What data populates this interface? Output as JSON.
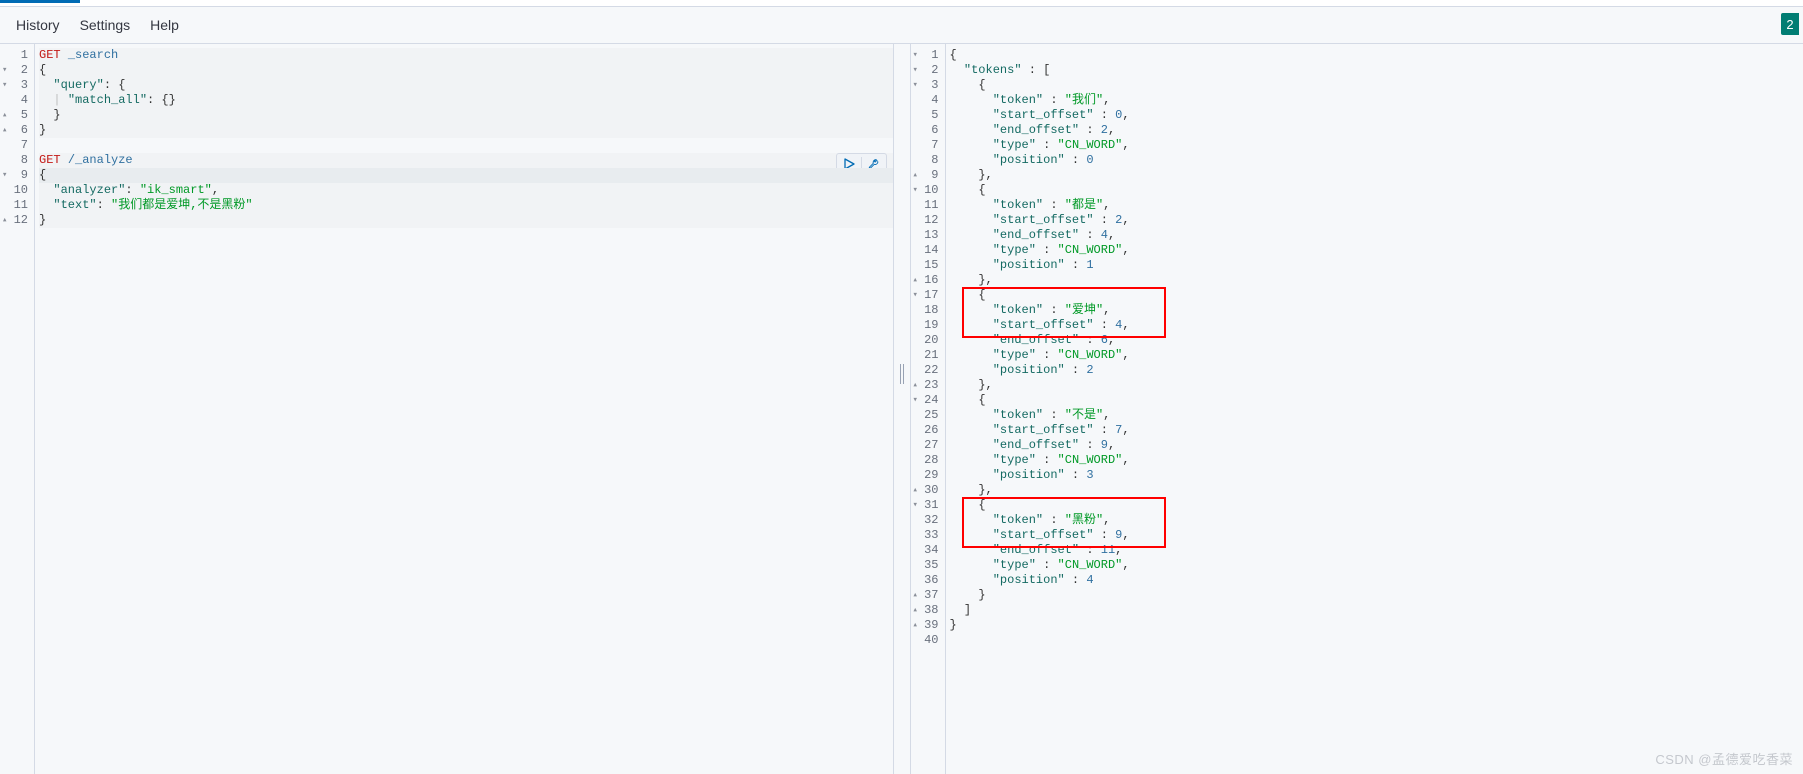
{
  "menu": {
    "history": "History",
    "settings": "Settings",
    "help": "Help",
    "badge": "2"
  },
  "request": {
    "active_line": 9,
    "lines": [
      {
        "n": 1,
        "fold": "",
        "parts": [
          {
            "c": "m",
            "t": "GET"
          },
          {
            "c": "pl",
            "t": " "
          },
          {
            "c": "p",
            "t": "_search"
          }
        ],
        "bg": "q1qbg"
      },
      {
        "n": 2,
        "fold": "▾",
        "parts": [
          {
            "c": "pu",
            "t": "{"
          }
        ],
        "bg": "q1qbg"
      },
      {
        "n": 3,
        "fold": "▾",
        "parts": [
          {
            "c": "pl",
            "t": "  "
          },
          {
            "c": "k",
            "t": "\"query\""
          },
          {
            "c": "pu",
            "t": ": {"
          }
        ],
        "bg": "q1qbg"
      },
      {
        "n": 4,
        "fold": "",
        "parts": [
          {
            "c": "pl",
            "t": "  "
          },
          {
            "c": "ig",
            "t": "|"
          },
          {
            "c": "pl",
            "t": " "
          },
          {
            "c": "k",
            "t": "\"match_all\""
          },
          {
            "c": "pu",
            "t": ": {}"
          }
        ],
        "bg": "q1qbg"
      },
      {
        "n": 5,
        "fold": "▴",
        "parts": [
          {
            "c": "pl",
            "t": "  "
          },
          {
            "c": "pu",
            "t": "}"
          }
        ],
        "bg": "q1qbg"
      },
      {
        "n": 6,
        "fold": "▴",
        "parts": [
          {
            "c": "pu",
            "t": "}"
          }
        ],
        "bg": "q1qbg"
      },
      {
        "n": 7,
        "fold": "",
        "parts": [
          {
            "c": "pl",
            "t": " "
          }
        ]
      },
      {
        "n": 8,
        "fold": "",
        "parts": [
          {
            "c": "m",
            "t": "GET"
          },
          {
            "c": "pl",
            "t": " "
          },
          {
            "c": "p",
            "t": "/_analyze"
          }
        ],
        "bg": "q1qbg",
        "actions": true
      },
      {
        "n": 9,
        "fold": "▾",
        "parts": [
          {
            "c": "pu",
            "t": "{"
          }
        ],
        "bg": "current"
      },
      {
        "n": 10,
        "fold": "",
        "parts": [
          {
            "c": "pl",
            "t": "  "
          },
          {
            "c": "k",
            "t": "\"analyzer\""
          },
          {
            "c": "pu",
            "t": ": "
          },
          {
            "c": "s",
            "t": "\"ik_smart\""
          },
          {
            "c": "pu",
            "t": ","
          }
        ],
        "bg": "q1qbg"
      },
      {
        "n": 11,
        "fold": "",
        "parts": [
          {
            "c": "pl",
            "t": "  "
          },
          {
            "c": "k",
            "t": "\"text\""
          },
          {
            "c": "pu",
            "t": ": "
          },
          {
            "c": "s",
            "t": "\"我们都是爱坤,不是黑粉\""
          }
        ],
        "bg": "q1qbg"
      },
      {
        "n": 12,
        "fold": "▴",
        "parts": [
          {
            "c": "pu",
            "t": "}"
          }
        ],
        "bg": "q1qbg"
      }
    ]
  },
  "response": {
    "highlights": [
      {
        "top_line": 17,
        "bottom_line": 19
      },
      {
        "top_line": 31,
        "bottom_line": 33
      }
    ],
    "lines": [
      {
        "n": 1,
        "fold": "▾",
        "parts": [
          {
            "c": "pu",
            "t": "{"
          }
        ]
      },
      {
        "n": 2,
        "fold": "▾",
        "parts": [
          {
            "c": "pl",
            "t": "  "
          },
          {
            "c": "k",
            "t": "\"tokens\""
          },
          {
            "c": "pu",
            "t": " : ["
          }
        ]
      },
      {
        "n": 3,
        "fold": "▾",
        "parts": [
          {
            "c": "pl",
            "t": "    "
          },
          {
            "c": "pu",
            "t": "{"
          }
        ]
      },
      {
        "n": 4,
        "fold": "",
        "parts": [
          {
            "c": "pl",
            "t": "      "
          },
          {
            "c": "k",
            "t": "\"token\""
          },
          {
            "c": "pu",
            "t": " : "
          },
          {
            "c": "s",
            "t": "\"我们\""
          },
          {
            "c": "pu",
            "t": ","
          }
        ]
      },
      {
        "n": 5,
        "fold": "",
        "parts": [
          {
            "c": "pl",
            "t": "      "
          },
          {
            "c": "k",
            "t": "\"start_offset\""
          },
          {
            "c": "pu",
            "t": " : "
          },
          {
            "c": "p",
            "t": "0"
          },
          {
            "c": "pu",
            "t": ","
          }
        ]
      },
      {
        "n": 6,
        "fold": "",
        "parts": [
          {
            "c": "pl",
            "t": "      "
          },
          {
            "c": "k",
            "t": "\"end_offset\""
          },
          {
            "c": "pu",
            "t": " : "
          },
          {
            "c": "p",
            "t": "2"
          },
          {
            "c": "pu",
            "t": ","
          }
        ]
      },
      {
        "n": 7,
        "fold": "",
        "parts": [
          {
            "c": "pl",
            "t": "      "
          },
          {
            "c": "k",
            "t": "\"type\""
          },
          {
            "c": "pu",
            "t": " : "
          },
          {
            "c": "s",
            "t": "\"CN_WORD\""
          },
          {
            "c": "pu",
            "t": ","
          }
        ]
      },
      {
        "n": 8,
        "fold": "",
        "parts": [
          {
            "c": "pl",
            "t": "      "
          },
          {
            "c": "k",
            "t": "\"position\""
          },
          {
            "c": "pu",
            "t": " : "
          },
          {
            "c": "p",
            "t": "0"
          }
        ]
      },
      {
        "n": 9,
        "fold": "▴",
        "parts": [
          {
            "c": "pl",
            "t": "    "
          },
          {
            "c": "pu",
            "t": "},"
          }
        ]
      },
      {
        "n": 10,
        "fold": "▾",
        "parts": [
          {
            "c": "pl",
            "t": "    "
          },
          {
            "c": "pu",
            "t": "{"
          }
        ]
      },
      {
        "n": 11,
        "fold": "",
        "parts": [
          {
            "c": "pl",
            "t": "      "
          },
          {
            "c": "k",
            "t": "\"token\""
          },
          {
            "c": "pu",
            "t": " : "
          },
          {
            "c": "s",
            "t": "\"都是\""
          },
          {
            "c": "pu",
            "t": ","
          }
        ]
      },
      {
        "n": 12,
        "fold": "",
        "parts": [
          {
            "c": "pl",
            "t": "      "
          },
          {
            "c": "k",
            "t": "\"start_offset\""
          },
          {
            "c": "pu",
            "t": " : "
          },
          {
            "c": "p",
            "t": "2"
          },
          {
            "c": "pu",
            "t": ","
          }
        ]
      },
      {
        "n": 13,
        "fold": "",
        "parts": [
          {
            "c": "pl",
            "t": "      "
          },
          {
            "c": "k",
            "t": "\"end_offset\""
          },
          {
            "c": "pu",
            "t": " : "
          },
          {
            "c": "p",
            "t": "4"
          },
          {
            "c": "pu",
            "t": ","
          }
        ]
      },
      {
        "n": 14,
        "fold": "",
        "parts": [
          {
            "c": "pl",
            "t": "      "
          },
          {
            "c": "k",
            "t": "\"type\""
          },
          {
            "c": "pu",
            "t": " : "
          },
          {
            "c": "s",
            "t": "\"CN_WORD\""
          },
          {
            "c": "pu",
            "t": ","
          }
        ]
      },
      {
        "n": 15,
        "fold": "",
        "parts": [
          {
            "c": "pl",
            "t": "      "
          },
          {
            "c": "k",
            "t": "\"position\""
          },
          {
            "c": "pu",
            "t": " : "
          },
          {
            "c": "p",
            "t": "1"
          }
        ]
      },
      {
        "n": 16,
        "fold": "▴",
        "parts": [
          {
            "c": "pl",
            "t": "    "
          },
          {
            "c": "pu",
            "t": "},"
          }
        ]
      },
      {
        "n": 17,
        "fold": "▾",
        "parts": [
          {
            "c": "pl",
            "t": "    "
          },
          {
            "c": "pu",
            "t": "{"
          }
        ]
      },
      {
        "n": 18,
        "fold": "",
        "parts": [
          {
            "c": "pl",
            "t": "      "
          },
          {
            "c": "k",
            "t": "\"token\""
          },
          {
            "c": "pu",
            "t": " : "
          },
          {
            "c": "s",
            "t": "\"爱坤\""
          },
          {
            "c": "pu",
            "t": ","
          }
        ]
      },
      {
        "n": 19,
        "fold": "",
        "parts": [
          {
            "c": "pl",
            "t": "      "
          },
          {
            "c": "k",
            "t": "\"start_offset\""
          },
          {
            "c": "pu",
            "t": " : "
          },
          {
            "c": "p",
            "t": "4"
          },
          {
            "c": "pu",
            "t": ","
          }
        ]
      },
      {
        "n": 20,
        "fold": "",
        "parts": [
          {
            "c": "pl",
            "t": "      "
          },
          {
            "c": "k",
            "t": "\"end_offset\""
          },
          {
            "c": "pu",
            "t": " : "
          },
          {
            "c": "p",
            "t": "6"
          },
          {
            "c": "pu",
            "t": ","
          }
        ]
      },
      {
        "n": 21,
        "fold": "",
        "parts": [
          {
            "c": "pl",
            "t": "      "
          },
          {
            "c": "k",
            "t": "\"type\""
          },
          {
            "c": "pu",
            "t": " : "
          },
          {
            "c": "s",
            "t": "\"CN_WORD\""
          },
          {
            "c": "pu",
            "t": ","
          }
        ]
      },
      {
        "n": 22,
        "fold": "",
        "parts": [
          {
            "c": "pl",
            "t": "      "
          },
          {
            "c": "k",
            "t": "\"position\""
          },
          {
            "c": "pu",
            "t": " : "
          },
          {
            "c": "p",
            "t": "2"
          }
        ]
      },
      {
        "n": 23,
        "fold": "▴",
        "parts": [
          {
            "c": "pl",
            "t": "    "
          },
          {
            "c": "pu",
            "t": "},"
          }
        ]
      },
      {
        "n": 24,
        "fold": "▾",
        "parts": [
          {
            "c": "pl",
            "t": "    "
          },
          {
            "c": "pu",
            "t": "{"
          }
        ]
      },
      {
        "n": 25,
        "fold": "",
        "parts": [
          {
            "c": "pl",
            "t": "      "
          },
          {
            "c": "k",
            "t": "\"token\""
          },
          {
            "c": "pu",
            "t": " : "
          },
          {
            "c": "s",
            "t": "\"不是\""
          },
          {
            "c": "pu",
            "t": ","
          }
        ]
      },
      {
        "n": 26,
        "fold": "",
        "parts": [
          {
            "c": "pl",
            "t": "      "
          },
          {
            "c": "k",
            "t": "\"start_offset\""
          },
          {
            "c": "pu",
            "t": " : "
          },
          {
            "c": "p",
            "t": "7"
          },
          {
            "c": "pu",
            "t": ","
          }
        ]
      },
      {
        "n": 27,
        "fold": "",
        "parts": [
          {
            "c": "pl",
            "t": "      "
          },
          {
            "c": "k",
            "t": "\"end_offset\""
          },
          {
            "c": "pu",
            "t": " : "
          },
          {
            "c": "p",
            "t": "9"
          },
          {
            "c": "pu",
            "t": ","
          }
        ]
      },
      {
        "n": 28,
        "fold": "",
        "parts": [
          {
            "c": "pl",
            "t": "      "
          },
          {
            "c": "k",
            "t": "\"type\""
          },
          {
            "c": "pu",
            "t": " : "
          },
          {
            "c": "s",
            "t": "\"CN_WORD\""
          },
          {
            "c": "pu",
            "t": ","
          }
        ]
      },
      {
        "n": 29,
        "fold": "",
        "parts": [
          {
            "c": "pl",
            "t": "      "
          },
          {
            "c": "k",
            "t": "\"position\""
          },
          {
            "c": "pu",
            "t": " : "
          },
          {
            "c": "p",
            "t": "3"
          }
        ]
      },
      {
        "n": 30,
        "fold": "▴",
        "parts": [
          {
            "c": "pl",
            "t": "    "
          },
          {
            "c": "pu",
            "t": "},"
          }
        ]
      },
      {
        "n": 31,
        "fold": "▾",
        "parts": [
          {
            "c": "pl",
            "t": "    "
          },
          {
            "c": "pu",
            "t": "{"
          }
        ]
      },
      {
        "n": 32,
        "fold": "",
        "parts": [
          {
            "c": "pl",
            "t": "      "
          },
          {
            "c": "k",
            "t": "\"token\""
          },
          {
            "c": "pu",
            "t": " : "
          },
          {
            "c": "s",
            "t": "\"黑粉\""
          },
          {
            "c": "pu",
            "t": ","
          }
        ]
      },
      {
        "n": 33,
        "fold": "",
        "parts": [
          {
            "c": "pl",
            "t": "      "
          },
          {
            "c": "k",
            "t": "\"start_offset\""
          },
          {
            "c": "pu",
            "t": " : "
          },
          {
            "c": "p",
            "t": "9"
          },
          {
            "c": "pu",
            "t": ","
          }
        ]
      },
      {
        "n": 34,
        "fold": "",
        "parts": [
          {
            "c": "pl",
            "t": "      "
          },
          {
            "c": "k",
            "t": "\"end_offset\""
          },
          {
            "c": "pu",
            "t": " : "
          },
          {
            "c": "p",
            "t": "11"
          },
          {
            "c": "pu",
            "t": ","
          }
        ]
      },
      {
        "n": 35,
        "fold": "",
        "parts": [
          {
            "c": "pl",
            "t": "      "
          },
          {
            "c": "k",
            "t": "\"type\""
          },
          {
            "c": "pu",
            "t": " : "
          },
          {
            "c": "s",
            "t": "\"CN_WORD\""
          },
          {
            "c": "pu",
            "t": ","
          }
        ]
      },
      {
        "n": 36,
        "fold": "",
        "parts": [
          {
            "c": "pl",
            "t": "      "
          },
          {
            "c": "k",
            "t": "\"position\""
          },
          {
            "c": "pu",
            "t": " : "
          },
          {
            "c": "p",
            "t": "4"
          }
        ]
      },
      {
        "n": 37,
        "fold": "▴",
        "parts": [
          {
            "c": "pl",
            "t": "    "
          },
          {
            "c": "pu",
            "t": "}"
          }
        ]
      },
      {
        "n": 38,
        "fold": "▴",
        "parts": [
          {
            "c": "pl",
            "t": "  "
          },
          {
            "c": "pu",
            "t": "]"
          }
        ]
      },
      {
        "n": 39,
        "fold": "▴",
        "parts": [
          {
            "c": "pu",
            "t": "}"
          }
        ]
      },
      {
        "n": 40,
        "fold": "",
        "parts": [
          {
            "c": "pl",
            "t": " "
          }
        ]
      }
    ]
  },
  "watermark": "CSDN @孟德爱吃香菜"
}
